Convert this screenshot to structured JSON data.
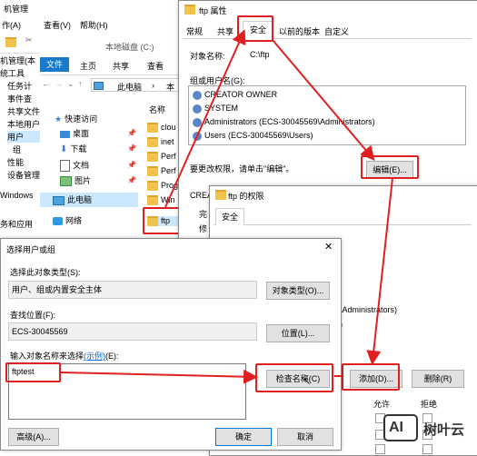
{
  "mmc": {
    "title": "机管理",
    "menu": [
      "作(A)",
      "查看(V)",
      "帮助(H)"
    ],
    "tree": [
      "机管理(本",
      "统工具",
      "任务计",
      "事件查",
      "共享文件",
      "本地用户",
      "用户",
      "组",
      "性能",
      "设备管理",
      "Windows",
      "务和应用"
    ]
  },
  "explorer": {
    "title": "本地磁盘 (C:)",
    "ribbon_tabs": [
      "文件",
      "主页",
      "共享",
      "查看"
    ],
    "address": "此电脑",
    "address_sep": "›",
    "address_end": "本",
    "column_name": "名称",
    "nav": [
      "快速访问",
      "桌面",
      "下载",
      "文档",
      "图片",
      "此电脑",
      "网络"
    ],
    "files": [
      "clou",
      "inet",
      "Perf",
      "Perf",
      "Prog",
      "Win",
      "ftp"
    ]
  },
  "props": {
    "title": "ftp 属性",
    "tabs": [
      "常规",
      "共享",
      "安全",
      "以前的版本",
      "自定义"
    ],
    "object_label": "对象名称:",
    "object_value": "C:\\ftp",
    "group_label": "组或用户名(G):",
    "users": [
      "CREATOR OWNER",
      "SYSTEM",
      "Administrators (ECS-30045569\\Administrators)",
      "Users (ECS-30045569\\Users)"
    ],
    "hint": "要更改权限，请单击\"编辑\"。",
    "edit_button": "编辑(E)...",
    "crea": "CREA",
    "perm_side": [
      "完",
      "修"
    ]
  },
  "perm": {
    "title": "ftp 的权限",
    "tab": "安全",
    "admin_line": "5\\Administrators)",
    "users_line": "5)",
    "add_button": "添加(D)...",
    "remove_button": "删除(R)",
    "allow": "允许",
    "deny": "拒绝"
  },
  "select": {
    "title": "选择用户或组",
    "type_label": "选择此对象类型(S):",
    "type_value": "用户、组或内置安全主体",
    "type_button": "对象类型(O)...",
    "loc_label": "查找位置(F):",
    "loc_value": "ECS-30045569",
    "loc_button": "位置(L)...",
    "input_label": "输入对象名称来选择",
    "input_link": "(示例)",
    "input_suffix": "(E):",
    "input_value": "ftptest",
    "check_button": "检查名称(C)",
    "adv_button": "高级(A)...",
    "ok_button": "确定",
    "cancel_button": "取消"
  },
  "watermark": {
    "text": "树叶云",
    "badge": "AI"
  },
  "colors": {
    "highlight": "#e02020",
    "ribbon_file": "#1979ca",
    "link": "#0066cc"
  }
}
